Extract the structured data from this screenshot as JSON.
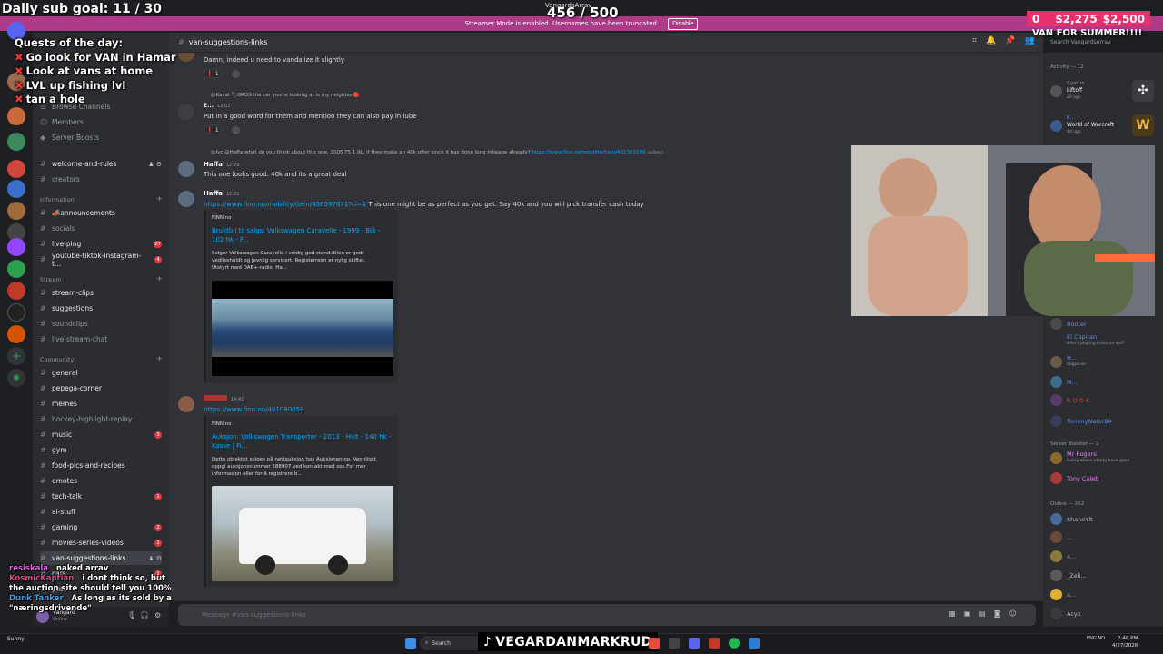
{
  "overlay": {
    "sub_goal": "Daily sub goal: 11 / 30",
    "counter": "456 / 500",
    "money_left": "0",
    "money_mid": "$2,275",
    "money_right": "$2,500",
    "van_summer": "VAN FOR SUMMER!!!!",
    "quests_title": "Quests of the day:",
    "quests": [
      "Go look for VAN in Hamar",
      "Look at vans at home",
      "LVL up fishing lvl",
      "tan a hole"
    ]
  },
  "banner": {
    "app_name": "VangardsArrav",
    "streamer_mode_text": "Streamer Mode is enabled. Usernames have been truncated.",
    "disable_label": "Disable"
  },
  "sidebar": {
    "browse_channels": "Browse Channels",
    "members": "Members",
    "server_boosts": "Server Boosts",
    "channels_top": [
      "welcome-and-rules",
      "creators"
    ],
    "cat_information": "Information",
    "info_channels": [
      {
        "name": "📣announcements",
        "badge": ""
      },
      {
        "name": "socials",
        "badge": ""
      },
      {
        "name": "live-ping",
        "badge": "27"
      },
      {
        "name": "youtube-tiktok-instagram-t...",
        "badge": "4"
      }
    ],
    "cat_stream": "Stream",
    "stream_channels": [
      "stream-clips",
      "suggestions",
      "soundclips",
      "live-stream-chat"
    ],
    "cat_community": "Community",
    "community_channels": [
      {
        "name": "general",
        "badge": ""
      },
      {
        "name": "pepega-corner",
        "badge": ""
      },
      {
        "name": "memes",
        "badge": ""
      },
      {
        "name": "hockey-highlight-replay",
        "badge": ""
      },
      {
        "name": "music",
        "badge": "3"
      },
      {
        "name": "gym",
        "badge": ""
      },
      {
        "name": "food-pics-and-recipes",
        "badge": ""
      },
      {
        "name": "emotes",
        "badge": ""
      },
      {
        "name": "tech-talk",
        "badge": "1"
      },
      {
        "name": "ai-stuff",
        "badge": ""
      },
      {
        "name": "gaming",
        "badge": "2"
      },
      {
        "name": "movies-series-videos",
        "badge": "1"
      },
      {
        "name": "van-suggestions-links",
        "badge": ""
      },
      {
        "name": "cars",
        "badge": "1"
      },
      {
        "name": "pets",
        "badge": ""
      }
    ]
  },
  "chat": {
    "channel": "van-suggestions-links",
    "m0_text": "Damn, indeed u need to vandalize it slightly",
    "m0_react_count": "1",
    "m1_reply": "@Kaval 🏷BROS the car you're looking at is my neighbor🔴",
    "m1_author": "E...",
    "m1_time": "12:02",
    "m1_text": "Put in a good word for them and mention they can also pay in lube",
    "m1_react_count": "1",
    "m2_reply": "@Ivc @Haffa what do you think about this one, 2005 T5 1.9L, if they make an 40k offer since it has done long mileage already?",
    "m2_reply_link": "https://www.finn.no/mobility/item/461362299",
    "m2_reply_edit": "(edited)",
    "m2_author": "Haffa",
    "m2_time": "12:29",
    "m2_text": "This one looks good. 40k and its a great deal",
    "m3_author": "Haffa",
    "m3_time": "12:31",
    "m3_link": "https://www.finn.no/mobility/item/456597671?ci=1",
    "m3_text": " This one might be as perfect as you get. Say 40k and you will pick transfer cash today",
    "e1_provider": "FINN.no",
    "e1_title": "Bruktbil til salgs: Volkswagen Caravelle - 1999 - Blå - 102 hk - F...",
    "e1_desc": "Selger Volkswagen Caravelle i veldig god stand.Bilen er godt vedlikeholdt og jevnlig servicert. Registerreim er nylig skiftet. Utstyrt med DAB+-radio. Ha...",
    "m4_time": "14:41",
    "m4_link": "https://www.finn.no/461080059",
    "e2_provider": "FINN.no",
    "e2_title": "Auksjon: Volkswagen Transporter - 2013 - Hvit - 140 hk - Kasse | Fi...",
    "e2_desc": "Dette objektet selges på nettauksjon hos Auksjonen.no. Vennligst oppgi auksjonsnummer 588907 ved kontakt med oss.For mer informasjon eller for å registrere b...",
    "input_placeholder": "Message #van-suggestions-links"
  },
  "members": {
    "search_placeholder": "Search VangardsArrav",
    "activity": "Activity — 12",
    "act1_name": "Cymrix",
    "act1_game": "Liftoff",
    "act1_time": "2d ago",
    "act2_name": "K...",
    "act2_game": "World of Warcraft",
    "act2_time": "4d ago",
    "list1": [
      {
        "name": "Booter",
        "color": "#5d8ef0",
        "sub": ""
      },
      {
        "name": "El Capitan",
        "color": "#5d8ef0",
        "sub": "Who's playing tricks on me?"
      },
      {
        "name": "H...",
        "color": "#5d8ef0",
        "sub": "bagpo.oo"
      },
      {
        "name": "M...",
        "color": "#5d8ef0",
        "sub": ""
      },
      {
        "name": "R O O K",
        "color": "#e04545",
        "sub": ""
      },
      {
        "name": "TommyNator84",
        "color": "#5d8ef0",
        "sub": ""
      }
    ],
    "booster_title": "Server Booster — 2",
    "boosters": [
      {
        "name": "Mr Rogers",
        "sub": "Going where plenty have gone..."
      },
      {
        "name": "Tony Caleb",
        "sub": ""
      }
    ],
    "online_title": "Online — 262",
    "online": [
      "$haneYlt",
      "...",
      "4...",
      "_Zeli...",
      "a...",
      "Acyx"
    ]
  },
  "overlay_chat": [
    {
      "user": "resiskala",
      "text": "naked arrav"
    },
    {
      "user": "KosmicKaptian",
      "text": "i dont think so, but the auction site should tell you 100%"
    },
    {
      "user": "Dunk Tanker",
      "text": "As long as its sold by a \"næringsdrivende\""
    }
  ],
  "user_panel": {
    "name": "Vangard",
    "status": "Online"
  },
  "taskbar": {
    "search": "Search",
    "tiktok": "VEGARDANMARKRUD",
    "time": "2:48 PM",
    "date": "4/27/2026",
    "lang": "ENG NO",
    "left_text": "Sunny"
  },
  "colors": {
    "accent": "#5865f2",
    "banner": "#b03a8a",
    "money": "#e8316c",
    "link": "#00a8fc"
  }
}
